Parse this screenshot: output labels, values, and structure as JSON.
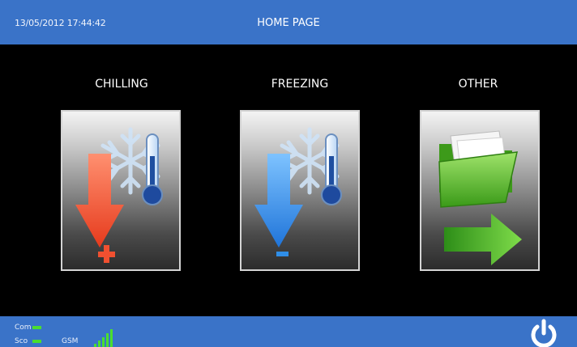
{
  "header": {
    "datetime": "13/05/2012 17:44:42",
    "title": "HOME PAGE"
  },
  "menu": [
    {
      "label": "CHILLING",
      "icon": "chilling-icon"
    },
    {
      "label": "FREEZING",
      "icon": "freezing-icon"
    },
    {
      "label": "OTHER",
      "icon": "other-icon"
    }
  ],
  "status": {
    "com_label": "Com",
    "sco_label": "Sco",
    "gsm_label": "GSM",
    "power_icon": "power-icon"
  },
  "colors": {
    "bar_blue": "#3a73c8",
    "background": "#000000",
    "led_green": "#4ade2e",
    "chill_red": "#f25a35",
    "freeze_blue": "#2f8ee8",
    "folder_green": "#5cc02a"
  }
}
